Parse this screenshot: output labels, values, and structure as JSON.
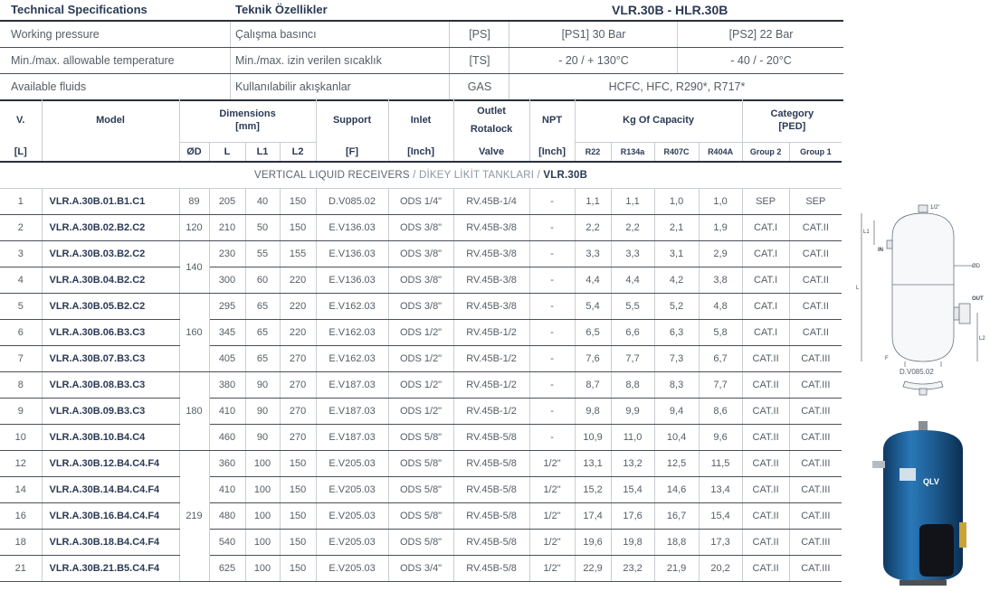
{
  "spec": {
    "header": {
      "col1": "Technical Specifications",
      "col2": "Teknik Özellikler",
      "col3": "VLR.30B - HLR.30B"
    },
    "rows": [
      {
        "en": "Working pressure",
        "tr": "Çalışma basıncı",
        "sym": "[PS]",
        "v1": "[PS1] 30 Bar",
        "v2": "[PS2] 22 Bar"
      },
      {
        "en": "Min./max. allowable temperature",
        "tr": "Min./max. izin verilen sıcaklık",
        "sym": "[TS]",
        "v1": "- 20 / + 130°C",
        "v2": "- 40 / - 20°C"
      },
      {
        "en": "Available fluids",
        "tr": "Kullanılabilir akışkanlar",
        "sym": "GAS",
        "v": "HCFC, HFC, R290*, R717*"
      }
    ]
  },
  "table": {
    "headers": {
      "v": "V.",
      "v_unit": "[L]",
      "model": "Model",
      "dimensions": "Dimensions",
      "dimensions_unit": "[mm]",
      "od": "ØD",
      "l": "L",
      "l1": "L1",
      "l2": "L2",
      "support": "Support",
      "support_unit": "[F]",
      "inlet": "Inlet",
      "inlet_unit": "[Inch]",
      "outlet": "Outlet",
      "outlet_2": "Rotalock",
      "outlet_3": "Valve",
      "npt": "NPT",
      "npt_unit": "[Inch]",
      "capacity": "Kg Of Capacity",
      "r22": "R22",
      "r134a": "R134a",
      "r407c": "R407C",
      "r404a": "R404A",
      "category": "Category",
      "category_unit": "[PED]",
      "group2": "Group 2",
      "group1": "Group 1"
    },
    "section": {
      "en": "VERTICAL LIQUID RECEIVERS",
      "slash1": "/",
      "tr": "DİKEY LİKİT TANKLARI",
      "slash2": "/",
      "code": "VLR.30B"
    },
    "diameters": [
      "89",
      "120",
      "140",
      "160",
      "180",
      "219"
    ],
    "rows": [
      {
        "v": "1",
        "model": "VLR.A.30B.01.B1.C1",
        "l": "205",
        "l1": "40",
        "l2": "150",
        "support": "D.V085.02",
        "inlet": "ODS 1/4\"",
        "outlet": "RV.45B-1/4",
        "npt": "-",
        "r22": "1,1",
        "r134a": "1,1",
        "r407c": "1,0",
        "r404a": "1,0",
        "g2": "SEP",
        "g1": "SEP"
      },
      {
        "v": "2",
        "model": "VLR.A.30B.02.B2.C2",
        "l": "210",
        "l1": "50",
        "l2": "150",
        "support": "E.V136.03",
        "inlet": "ODS 3/8\"",
        "outlet": "RV.45B-3/8",
        "npt": "-",
        "r22": "2,2",
        "r134a": "2,2",
        "r407c": "2,1",
        "r404a": "1,9",
        "g2": "CAT.I",
        "g1": "CAT.II"
      },
      {
        "v": "3",
        "model": "VLR.A.30B.03.B2.C2",
        "l": "230",
        "l1": "55",
        "l2": "155",
        "support": "E.V136.03",
        "inlet": "ODS 3/8\"",
        "outlet": "RV.45B-3/8",
        "npt": "-",
        "r22": "3,3",
        "r134a": "3,3",
        "r407c": "3,1",
        "r404a": "2,9",
        "g2": "CAT.I",
        "g1": "CAT.II"
      },
      {
        "v": "4",
        "model": "VLR.A.30B.04.B2.C2",
        "l": "300",
        "l1": "60",
        "l2": "220",
        "support": "E.V136.03",
        "inlet": "ODS 3/8\"",
        "outlet": "RV.45B-3/8",
        "npt": "-",
        "r22": "4,4",
        "r134a": "4,4",
        "r407c": "4,2",
        "r404a": "3,8",
        "g2": "CAT.I",
        "g1": "CAT.II"
      },
      {
        "v": "5",
        "model": "VLR.A.30B.05.B2.C2",
        "l": "295",
        "l1": "65",
        "l2": "220",
        "support": "E.V162.03",
        "inlet": "ODS 3/8\"",
        "outlet": "RV.45B-3/8",
        "npt": "-",
        "r22": "5,4",
        "r134a": "5,5",
        "r407c": "5,2",
        "r404a": "4,8",
        "g2": "CAT.I",
        "g1": "CAT.II"
      },
      {
        "v": "6",
        "model": "VLR.A.30B.06.B3.C3",
        "l": "345",
        "l1": "65",
        "l2": "220",
        "support": "E.V162.03",
        "inlet": "ODS 1/2\"",
        "outlet": "RV.45B-1/2",
        "npt": "-",
        "r22": "6,5",
        "r134a": "6,6",
        "r407c": "6,3",
        "r404a": "5,8",
        "g2": "CAT.I",
        "g1": "CAT.II"
      },
      {
        "v": "7",
        "model": "VLR.A.30B.07.B3.C3",
        "l": "405",
        "l1": "65",
        "l2": "270",
        "support": "E.V162.03",
        "inlet": "ODS 1/2\"",
        "outlet": "RV.45B-1/2",
        "npt": "-",
        "r22": "7,6",
        "r134a": "7,7",
        "r407c": "7,3",
        "r404a": "6,7",
        "g2": "CAT.II",
        "g1": "CAT.III"
      },
      {
        "v": "8",
        "model": "VLR.A.30B.08.B3.C3",
        "l": "380",
        "l1": "90",
        "l2": "270",
        "support": "E.V187.03",
        "inlet": "ODS 1/2\"",
        "outlet": "RV.45B-1/2",
        "npt": "-",
        "r22": "8,7",
        "r134a": "8,8",
        "r407c": "8,3",
        "r404a": "7,7",
        "g2": "CAT.II",
        "g1": "CAT.III"
      },
      {
        "v": "9",
        "model": "VLR.A.30B.09.B3.C3",
        "l": "410",
        "l1": "90",
        "l2": "270",
        "support": "E.V187.03",
        "inlet": "ODS 1/2\"",
        "outlet": "RV.45B-1/2",
        "npt": "-",
        "r22": "9,8",
        "r134a": "9,9",
        "r407c": "9,4",
        "r404a": "8,6",
        "g2": "CAT.II",
        "g1": "CAT.III"
      },
      {
        "v": "10",
        "model": "VLR.A.30B.10.B4.C4",
        "l": "460",
        "l1": "90",
        "l2": "270",
        "support": "E.V187.03",
        "inlet": "ODS 5/8\"",
        "outlet": "RV.45B-5/8",
        "npt": "-",
        "r22": "10,9",
        "r134a": "11,0",
        "r407c": "10,4",
        "r404a": "9,6",
        "g2": "CAT.II",
        "g1": "CAT.III"
      },
      {
        "v": "12",
        "model": "VLR.A.30B.12.B4.C4.F4",
        "l": "360",
        "l1": "100",
        "l2": "150",
        "support": "E.V205.03",
        "inlet": "ODS 5/8\"",
        "outlet": "RV.45B-5/8",
        "npt": "1/2\"",
        "r22": "13,1",
        "r134a": "13,2",
        "r407c": "12,5",
        "r404a": "11,5",
        "g2": "CAT.II",
        "g1": "CAT.III"
      },
      {
        "v": "14",
        "model": "VLR.A.30B.14.B4.C4.F4",
        "l": "410",
        "l1": "100",
        "l2": "150",
        "support": "E.V205.03",
        "inlet": "ODS 5/8\"",
        "outlet": "RV.45B-5/8",
        "npt": "1/2\"",
        "r22": "15,2",
        "r134a": "15,4",
        "r407c": "14,6",
        "r404a": "13,4",
        "g2": "CAT.II",
        "g1": "CAT.III"
      },
      {
        "v": "16",
        "model": "VLR.A.30B.16.B4.C4.F4",
        "l": "480",
        "l1": "100",
        "l2": "150",
        "support": "E.V205.03",
        "inlet": "ODS 5/8\"",
        "outlet": "RV.45B-5/8",
        "npt": "1/2\"",
        "r22": "17,4",
        "r134a": "17,6",
        "r407c": "16,7",
        "r404a": "15,4",
        "g2": "CAT.II",
        "g1": "CAT.III"
      },
      {
        "v": "18",
        "model": "VLR.A.30B.18.B4.C4.F4",
        "l": "540",
        "l1": "100",
        "l2": "150",
        "support": "E.V205.03",
        "inlet": "ODS 5/8\"",
        "outlet": "RV.45B-5/8",
        "npt": "1/2\"",
        "r22": "19,6",
        "r134a": "19,8",
        "r407c": "18,8",
        "r404a": "17,3",
        "g2": "CAT.II",
        "g1": "CAT.III"
      },
      {
        "v": "21",
        "model": "VLR.A.30B.21.B5.C4.F4",
        "l": "625",
        "l1": "100",
        "l2": "150",
        "support": "E.V205.03",
        "inlet": "ODS 3/4\"",
        "outlet": "RV.45B-5/8",
        "npt": "1/2\"",
        "r22": "22,9",
        "r134a": "23,2",
        "r407c": "21,9",
        "r404a": "20,2",
        "g2": "CAT.II",
        "g1": "CAT.III"
      }
    ]
  },
  "diagram": {
    "top_label": "1/2\"",
    "l1": "L1",
    "in": "IN",
    "od": "ØD",
    "l": "L",
    "out": "OUT",
    "l2": "L2",
    "f": "F",
    "support_code": "D.V085.02"
  },
  "photo": {
    "brand": "QLV"
  },
  "colors": {
    "heading": "#2b3a55",
    "text": "#555d66",
    "rule": "#4a4f58",
    "grid": "#c9ced4",
    "tank_blue": "#1f5f96"
  }
}
